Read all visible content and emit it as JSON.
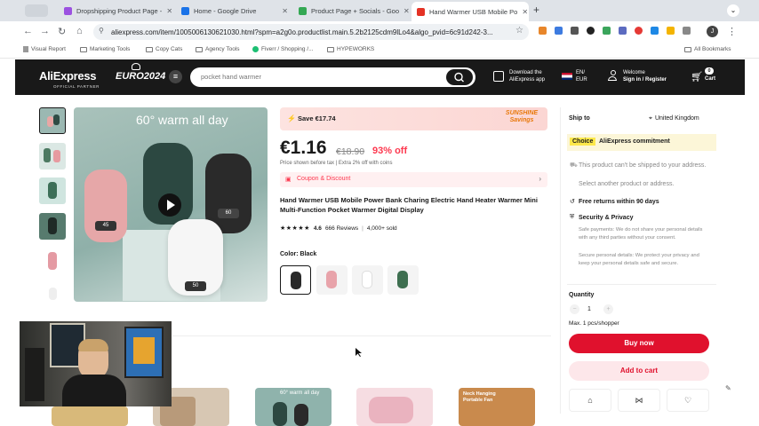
{
  "browser": {
    "tabs": [
      {
        "title": "Dropshipping Product Page -",
        "color": "#9b51e0"
      },
      {
        "title": "Home - Google Drive",
        "color": "#1a73e8"
      },
      {
        "title": "Product Page + Socials - Goo",
        "color": "#34a853"
      },
      {
        "title": "Hand Warmer USB Mobile Po",
        "color": "#e43225"
      }
    ],
    "url": "aliexpress.com/item/1005006130621030.html?spm=a2g0o.productlist.main.5.2b2125cdm9lLo4&algo_pvid=6c91d242-3...",
    "bookmarks": [
      "Visual Report",
      "Marketing Tools",
      "Copy Cats",
      "Agency Tools",
      "Fiverr / Shopping /...",
      "HYPEWORKS"
    ],
    "all_bookmarks": "All Bookmarks"
  },
  "header": {
    "logo": "AliExpress",
    "logo_sub": "OFFICIAL PARTNER",
    "euro": "EURO2024",
    "search_placeholder": "pocket hand warmer",
    "download_line1": "Download the",
    "download_line2": "AliExpress app",
    "lang_line1": "EN/",
    "lang_line2": "EUR",
    "welcome_line1": "Welcome",
    "welcome_line2": "Sign in / Register",
    "cart_label": "Cart",
    "cart_count": "0"
  },
  "gallery": {
    "image_text": "60° warm all day",
    "device_labels": [
      "45",
      "60",
      "50"
    ]
  },
  "product": {
    "save_label": "Save €17.74",
    "sunshine_label": "SUNSHINE Savings",
    "price": "€1.16",
    "old_price": "€18.90",
    "discount": "93% off",
    "tax_note": "Price shown before tax  |  Extra 2% off with coins",
    "coupon": "Coupon & Discount",
    "title": "Hand Warmer USB Mobile Power Bank Charing Electric Hand Heater Warmer Mini Multi-Function Pocket Warmer Digital Display",
    "stars": "★★★★★",
    "rating": "4.6",
    "reviews": "666 Reviews",
    "sold": "4,000+ sold",
    "color_label": "Color: Black"
  },
  "panel": {
    "ship_to": "Ship to",
    "country": "United Kingdom",
    "choice": "Choice",
    "commitment": "AliExpress commitment",
    "cant_ship": "This product can't be shipped to your address.",
    "select_other": "Select another product or address.",
    "free_returns": "Free returns within 90 days",
    "security_title": "Security & Privacy",
    "security_text1": "Safe payments: We do not share your personal details with any third parties without your consent.",
    "security_text2": "Secure personal details: We protect your privacy and keep your personal details safe and secure.",
    "quantity_label": "Quantity",
    "quantity_value": "1",
    "max_note": "Max. 1 pcs/shopper",
    "buy_now": "Buy now",
    "add_to_cart": "Add to cart"
  },
  "recommend": {
    "card2_text": "60° warm all day",
    "card4_text": "Neck Hanging Portable Fan"
  }
}
